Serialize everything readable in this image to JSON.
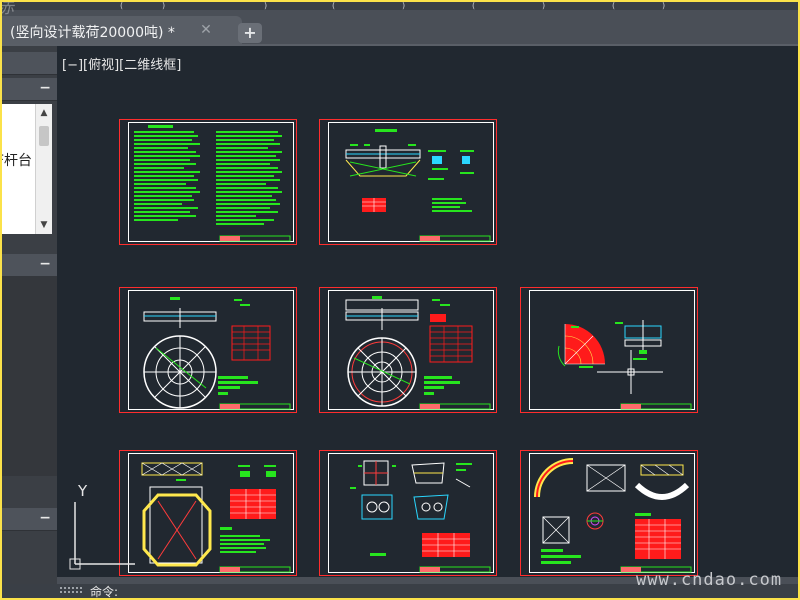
{
  "tab": {
    "title": "(竖向设计载荷20000吨)  *",
    "close_icon": "close-icon",
    "add_icon": "plus-icon"
  },
  "viewport": {
    "label": "[−][俯视][二维线框]",
    "ucs_y": "Y"
  },
  "palette": {
    "panel_text": "F杆台",
    "collapse_symbol": "−"
  },
  "command": {
    "text": "命令:"
  },
  "watermark": "www.cndao.com",
  "corner_mark": "赤",
  "colors": {
    "background": "#212830",
    "sheet_border": "#ff2d2d",
    "drawing_green": "#27e51e",
    "drawing_white": "#ffffff",
    "hatch_red": "#ff1b1b",
    "annotation_cyan": "#2ad7ff"
  },
  "sheets": [
    {
      "id": "sheet-1",
      "type": "notes"
    },
    {
      "id": "sheet-2",
      "type": "elevation-details"
    },
    {
      "id": "sheet-4",
      "type": "plan-circular"
    },
    {
      "id": "sheet-5",
      "type": "plan-circular"
    },
    {
      "id": "sheet-6",
      "type": "quadrant-detail"
    },
    {
      "id": "sheet-7",
      "type": "square-detail"
    },
    {
      "id": "sheet-8",
      "type": "section-details"
    },
    {
      "id": "sheet-9",
      "type": "arc-details"
    }
  ]
}
